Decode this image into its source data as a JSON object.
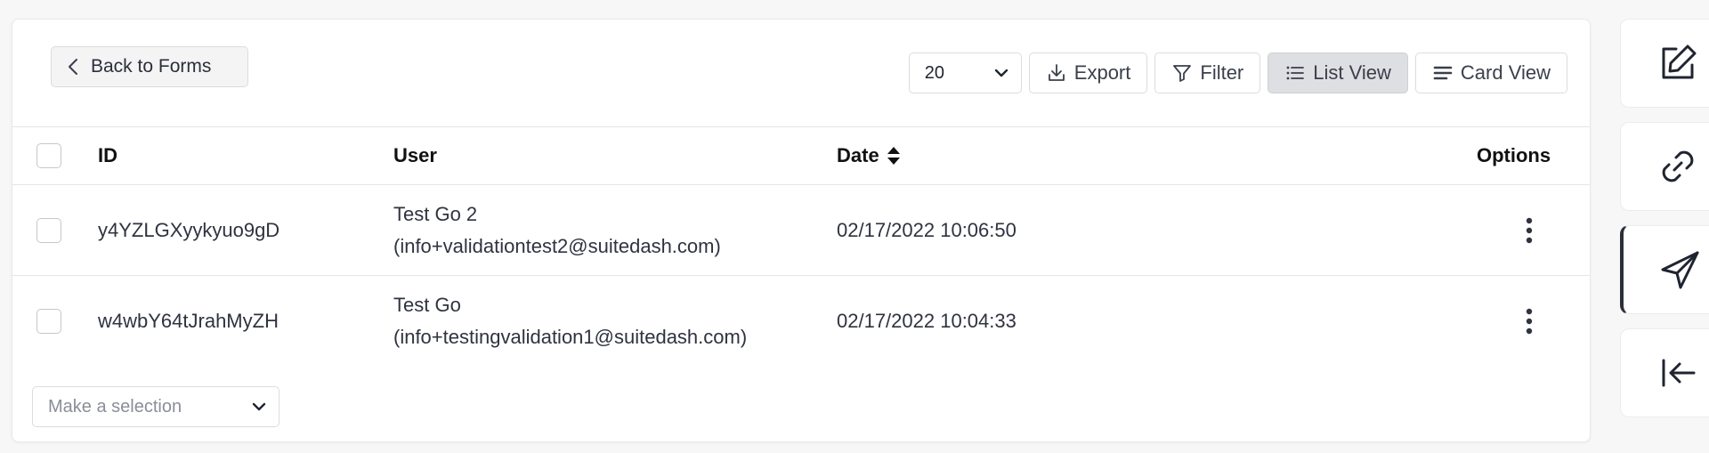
{
  "header": {
    "back_label": "Back to Forms"
  },
  "toolbar": {
    "per_page": "20",
    "export_label": "Export",
    "filter_label": "Filter",
    "list_view_label": "List View",
    "card_view_label": "Card View"
  },
  "table": {
    "columns": [
      "ID",
      "User",
      "Date",
      "Options"
    ],
    "rows": [
      {
        "id": "y4YZLGXyykyuo9gD",
        "user_name": "Test Go 2",
        "user_email": "(info+validationtest2@suitedash.com)",
        "date": "02/17/2022 10:06:50"
      },
      {
        "id": "w4wbY64tJrahMyZH",
        "user_name": "Test Go",
        "user_email": "(info+testingvalidation1@suitedash.com)",
        "date": "02/17/2022 10:04:33"
      }
    ]
  },
  "bulk_action": {
    "placeholder": "Make a selection"
  },
  "sidebar": {
    "tools": [
      "edit-icon",
      "link-icon",
      "send-icon",
      "collapse-icon"
    ],
    "active": "send-icon"
  },
  "colors": {
    "active_button_bg": "#dedfe2",
    "panel_bg": "#ffffff",
    "page_bg": "#f7f7f7"
  }
}
